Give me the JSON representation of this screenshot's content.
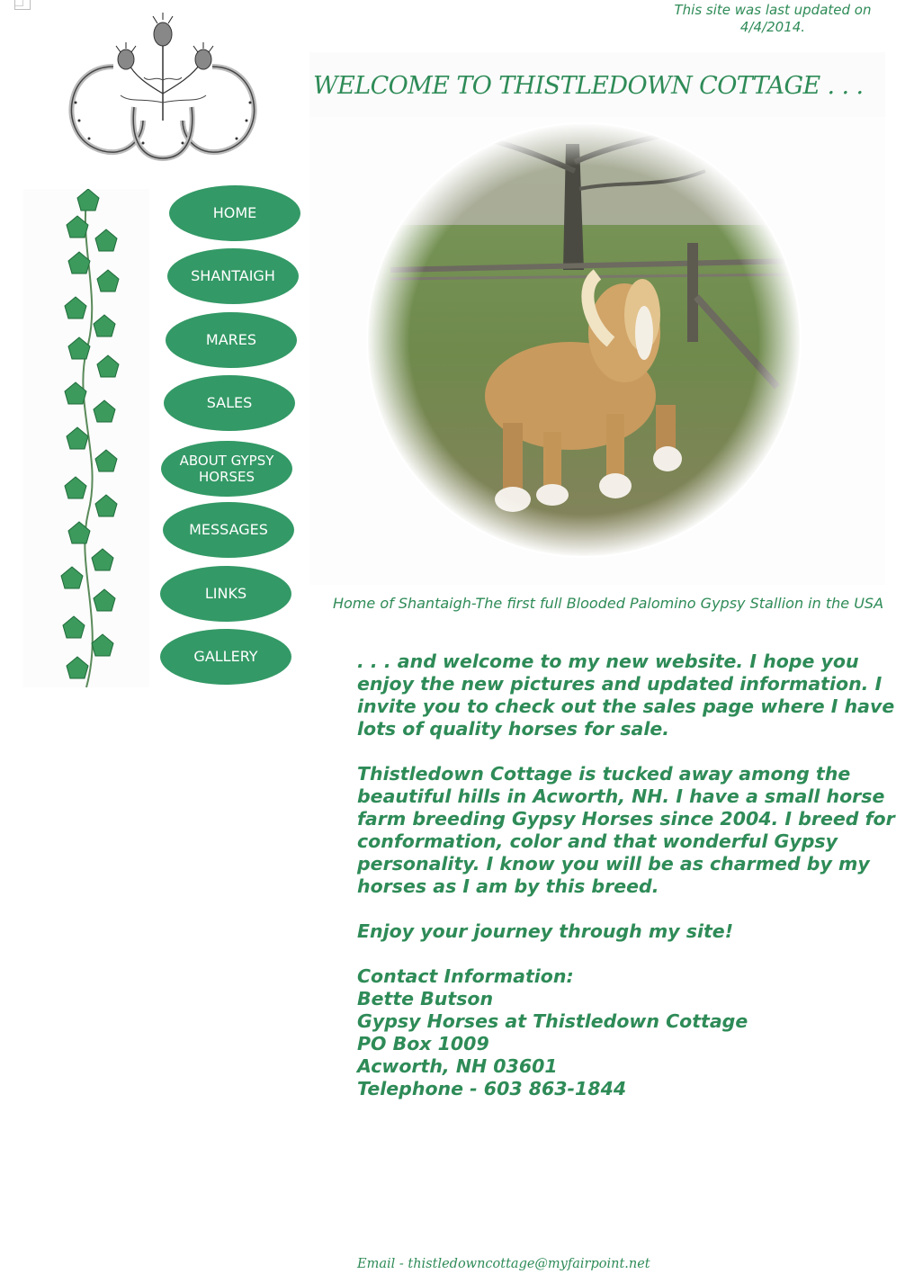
{
  "header": {
    "updated_line1": "This site was last updated on",
    "updated_line2": "4/4/2014."
  },
  "welcome": {
    "title": "WELCOME TO THISTLEDOWN COTTAGE . . ."
  },
  "nav": {
    "items": [
      {
        "label": "HOME"
      },
      {
        "label": "SHANTAIGH"
      },
      {
        "label": "MARES"
      },
      {
        "label": "SALES"
      },
      {
        "label": "ABOUT GYPSY HORSES"
      },
      {
        "label": "MESSAGES"
      },
      {
        "label": "LINKS"
      },
      {
        "label": "GALLERY"
      }
    ]
  },
  "photo": {
    "caption": "Home of Shantaigh-The first full Blooded Palomino Gypsy Stallion in the USA"
  },
  "content": {
    "intro": ". . . and welcome to my new website. I hope you enjoy the new pictures and updated information. I invite you to check out the sales page where I have lots of quality horses for sale.",
    "about": "Thistledown Cottage is tucked away among the beautiful hills in Acworth, NH. I have a small horse farm breeding Gypsy Horses since 2004. I breed for conformation, color and that wonderful Gypsy personality. I know you will be as charmed by my horses as I am by this breed.",
    "enjoy": "Enjoy your journey through my site!",
    "contact": {
      "heading": "Contact Information:",
      "name": "Bette Butson",
      "business": "Gypsy Horses at Thistledown Cottage",
      "po_box": "PO Box 1009",
      "city": "Acworth, NH 03601",
      "phone": "Telephone - 603 863-1844"
    }
  },
  "footer": {
    "email": "Email - thistledowncottage@myfairpoint.net"
  },
  "colors": {
    "accent": "#2e8b57",
    "button": "#339966"
  }
}
